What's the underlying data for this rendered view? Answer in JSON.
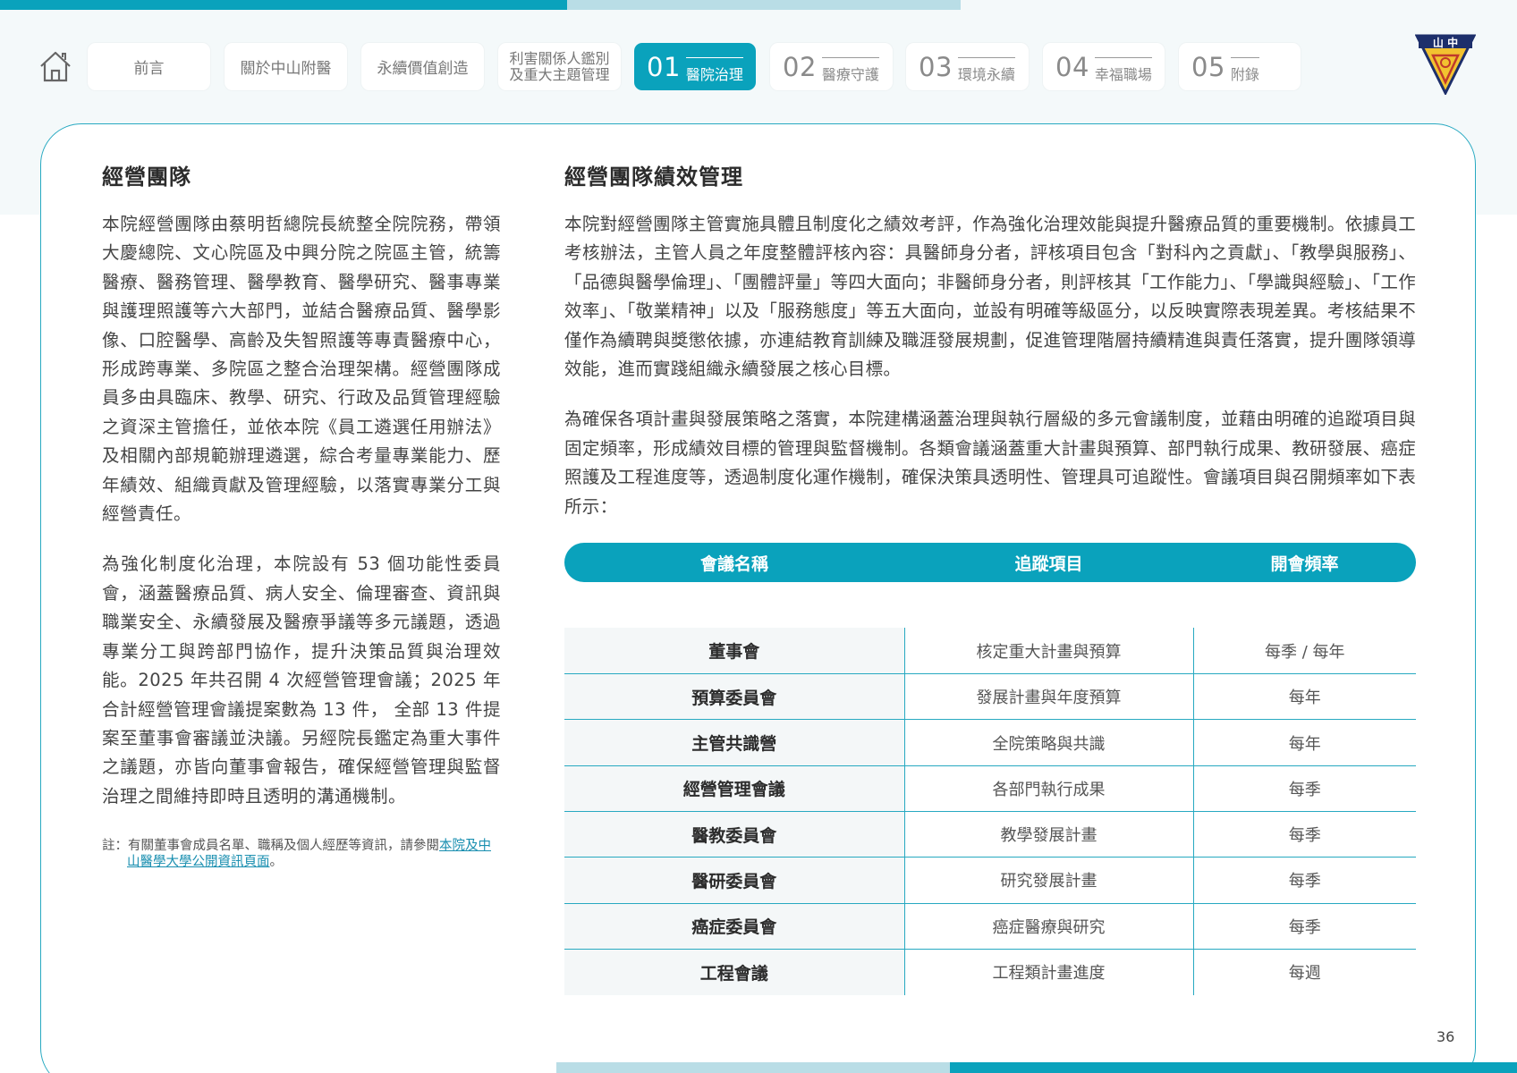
{
  "nav": {
    "tabs": [
      {
        "label": "前言"
      },
      {
        "label": "關於中山附醫"
      },
      {
        "label": "永續價值創造"
      },
      {
        "label": "利害關係人鑑別\n及重大主題管理"
      }
    ],
    "chapters": [
      {
        "num": "01",
        "label": "醫院治理",
        "active": true
      },
      {
        "num": "02",
        "label": "醫療守護"
      },
      {
        "num": "03",
        "label": "環境永續"
      },
      {
        "num": "04",
        "label": "幸福職場"
      },
      {
        "num": "05",
        "label": "附錄"
      }
    ],
    "home_icon": "home-icon"
  },
  "logo": {
    "text": "山中"
  },
  "left": {
    "heading": "經營團隊",
    "p1": "本院經營團隊由蔡明哲總院長統整全院院務，帶領大慶總院、文心院區及中興分院之院區主管，統籌醫療、醫務管理、醫學教育、醫學研究、醫事專業與護理照護等六大部門，並結合醫療品質、醫學影像、口腔醫學、高齡及失智照護等專責醫療中心，形成跨專業、多院區之整合治理架構。經營團隊成員多由具臨床、教學、研究、行政及品質管理經驗之資深主管擔任，並依本院《員工遴選任用辦法》及相關內部規範辦理遴選，綜合考量專業能力、歷年績效、組織貢獻及管理經驗，以落實專業分工與經營責任。",
    "p2": "為強化制度化治理，本院設有 53 個功能性委員會，涵蓋醫療品質、病人安全、倫理審查、資訊與職業安全、永續發展及醫療爭議等多元議題，透過專業分工與跨部門協作，提升決策品質與治理效能。2025 年共召開 4 次經營管理會議；2025 年合計經營管理會議提案數為 13 件， 全部 13 件提案至董事會審議並決議。另經院長鑑定為重大事件之議題，亦皆向董事會報告，確保經營管理與監督治理之間維持即時且透明的溝通機制。",
    "note_prefix": "註：有關董事會成員名單、職稱及個人經歷等資訊，請參閱",
    "note_link": "本院及中山醫學大學公開資訊頁面",
    "note_suffix": "。"
  },
  "right": {
    "heading": "經營團隊績效管理",
    "p1": "本院對經營團隊主管實施具體且制度化之績效考評，作為強化治理效能與提升醫療品質的重要機制。依據員工考核辦法，主管人員之年度整體評核內容：具醫師身分者，評核項目包含「對科內之貢獻」、「教學與服務」、「品德與醫學倫理」、「團體評量」等四大面向；非醫師身分者，則評核其「工作能力」、「學識與經驗」、「工作效率」、「敬業精神」以及「服務態度」等五大面向，並設有明確等級區分，以反映實際表現差異。考核結果不僅作為續聘與獎懲依據，亦連結教育訓練及職涯發展規劃，促進管理階層持續精進與責任落實，提升團隊領導效能，進而實踐組織永續發展之核心目標。",
    "p2": "為確保各項計畫與發展策略之落實，本院建構涵蓋治理與執行層級的多元會議制度，並藉由明確的追蹤項目與固定頻率，形成績效目標的管理與監督機制。各類會議涵蓋重大計畫與預算、部門執行成果、教研發展、癌症照護及工程進度等，透過制度化運作機制，確保決策具透明性、管理具可追蹤性。會議項目與召開頻率如下表所示："
  },
  "table": {
    "headers": [
      "會議名稱",
      "追蹤項目",
      "開會頻率"
    ],
    "rows": [
      [
        "董事會",
        "核定重大計畫與預算",
        "每季 / 每年"
      ],
      [
        "預算委員會",
        "發展計畫與年度預算",
        "每年"
      ],
      [
        "主管共識營",
        "全院策略與共識",
        "每年"
      ],
      [
        "經營管理會議",
        "各部門執行成果",
        "每季"
      ],
      [
        "醫教委員會",
        "教學發展計畫",
        "每季"
      ],
      [
        "醫研委員會",
        "研究發展計畫",
        "每季"
      ],
      [
        "癌症委員會",
        "癌症醫療與研究",
        "每季"
      ],
      [
        "工程會議",
        "工程類計畫進度",
        "每週"
      ]
    ]
  },
  "page_number": "36",
  "colors": {
    "accent": "#0aa2bc",
    "accent_light": "#b9dde6",
    "border": "#27a9c1"
  }
}
